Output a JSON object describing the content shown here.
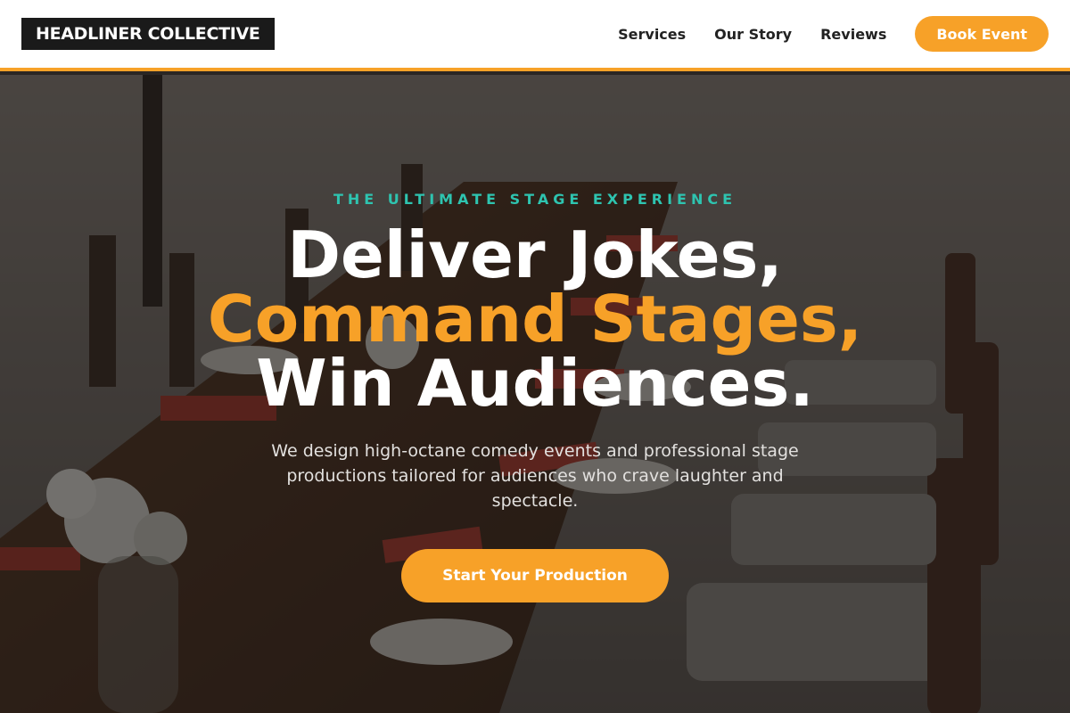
{
  "header": {
    "logo": "HEADLINER COLLECTIVE",
    "nav": [
      {
        "label": "Services"
      },
      {
        "label": "Our Story"
      },
      {
        "label": "Reviews"
      }
    ],
    "book_label": "Book Event"
  },
  "hero": {
    "eyebrow": "THE ULTIMATE STAGE EXPERIENCE",
    "headline_line1": "Deliver Jokes,",
    "headline_line2": "Command Stages,",
    "headline_line3": "Win Audiences.",
    "subtext": "We design high-octane comedy events and professional stage productions tailored for audiences who crave laughter and spectacle.",
    "cta_label": "Start Your Production"
  },
  "colors": {
    "accent": "#f7a128",
    "eyebrow": "#2ec4b0",
    "logo_bg": "#1a1a1a"
  }
}
